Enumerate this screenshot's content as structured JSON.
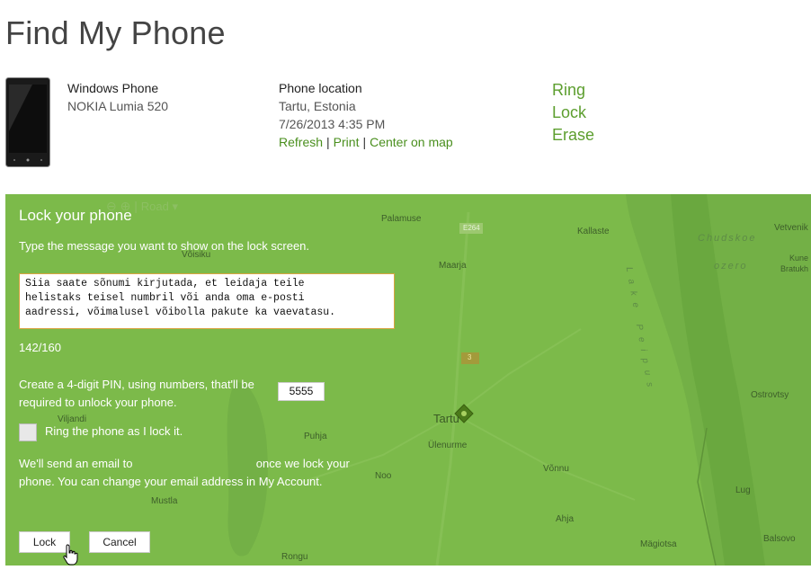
{
  "page": {
    "title": "Find My Phone"
  },
  "device": {
    "name": "Windows Phone",
    "model": "NOKIA Lumia 520"
  },
  "location": {
    "label": "Phone location",
    "place": "Tartu, Estonia",
    "timestamp": "7/26/2013 4:35 PM",
    "links": {
      "refresh": "Refresh",
      "print": "Print",
      "center": "Center on map",
      "separator": "|"
    }
  },
  "actions": {
    "ring": "Ring",
    "lock": "Lock",
    "erase": "Erase"
  },
  "map": {
    "controls": {
      "zoom_out": "⊖",
      "zoom_in": "⊕",
      "separator": "|",
      "mode": "Road ▾"
    },
    "places": {
      "palamuse": "Palamuse",
      "kallaste": "Kallaste",
      "vetvenik": "Vetvenik",
      "chudskoe": "Chudskoe",
      "ozero": "ozero",
      "kune": "Kune",
      "bratukh": "Bratukh",
      "maarja": "Maarja",
      "tartu": "Tartu",
      "ulenurme": "Ülenurme",
      "puhja": "Puhja",
      "viljandi": "Viljandi",
      "noo": "Noo",
      "vonnu": "Võnnu",
      "ostrovtsy": "Ostrovtsy",
      "lug": "Lug",
      "mustla": "Mustla",
      "ahja": "Ahja",
      "magiotsa": "Mägiotsa",
      "balsovo": "Balsovo",
      "rongu": "Rongu",
      "voisiku": "Võisiku",
      "road_e264": "E264",
      "road_3": "3"
    },
    "lake_label": "Lake Peipus"
  },
  "lock_panel": {
    "title": "Lock your phone",
    "instruction": "Type the message you want to show on the lock screen.",
    "message": "Siia saate sõnumi kirjutada, et leidaja teile\nhelistaks teisel numbril või anda oma e-posti\naadressi, võimalusel võibolla pakute ka vaevatasu.",
    "counter": "142/160",
    "pin_label": "Create a 4-digit PIN, using numbers, that'll be required to unlock your phone.",
    "pin_value": "5555",
    "ring_label": "Ring the phone as I lock it.",
    "email_note_pre": "We'll send an email to",
    "email_note_post": "once we lock your phone. You can change your email address in My Account.",
    "lock_button": "Lock",
    "cancel_button": "Cancel"
  },
  "colors": {
    "map_green": "#7cba4a",
    "link_green": "#4a8f1e",
    "action_green": "#5c9e2e",
    "textbox_border": "#d9a441"
  }
}
